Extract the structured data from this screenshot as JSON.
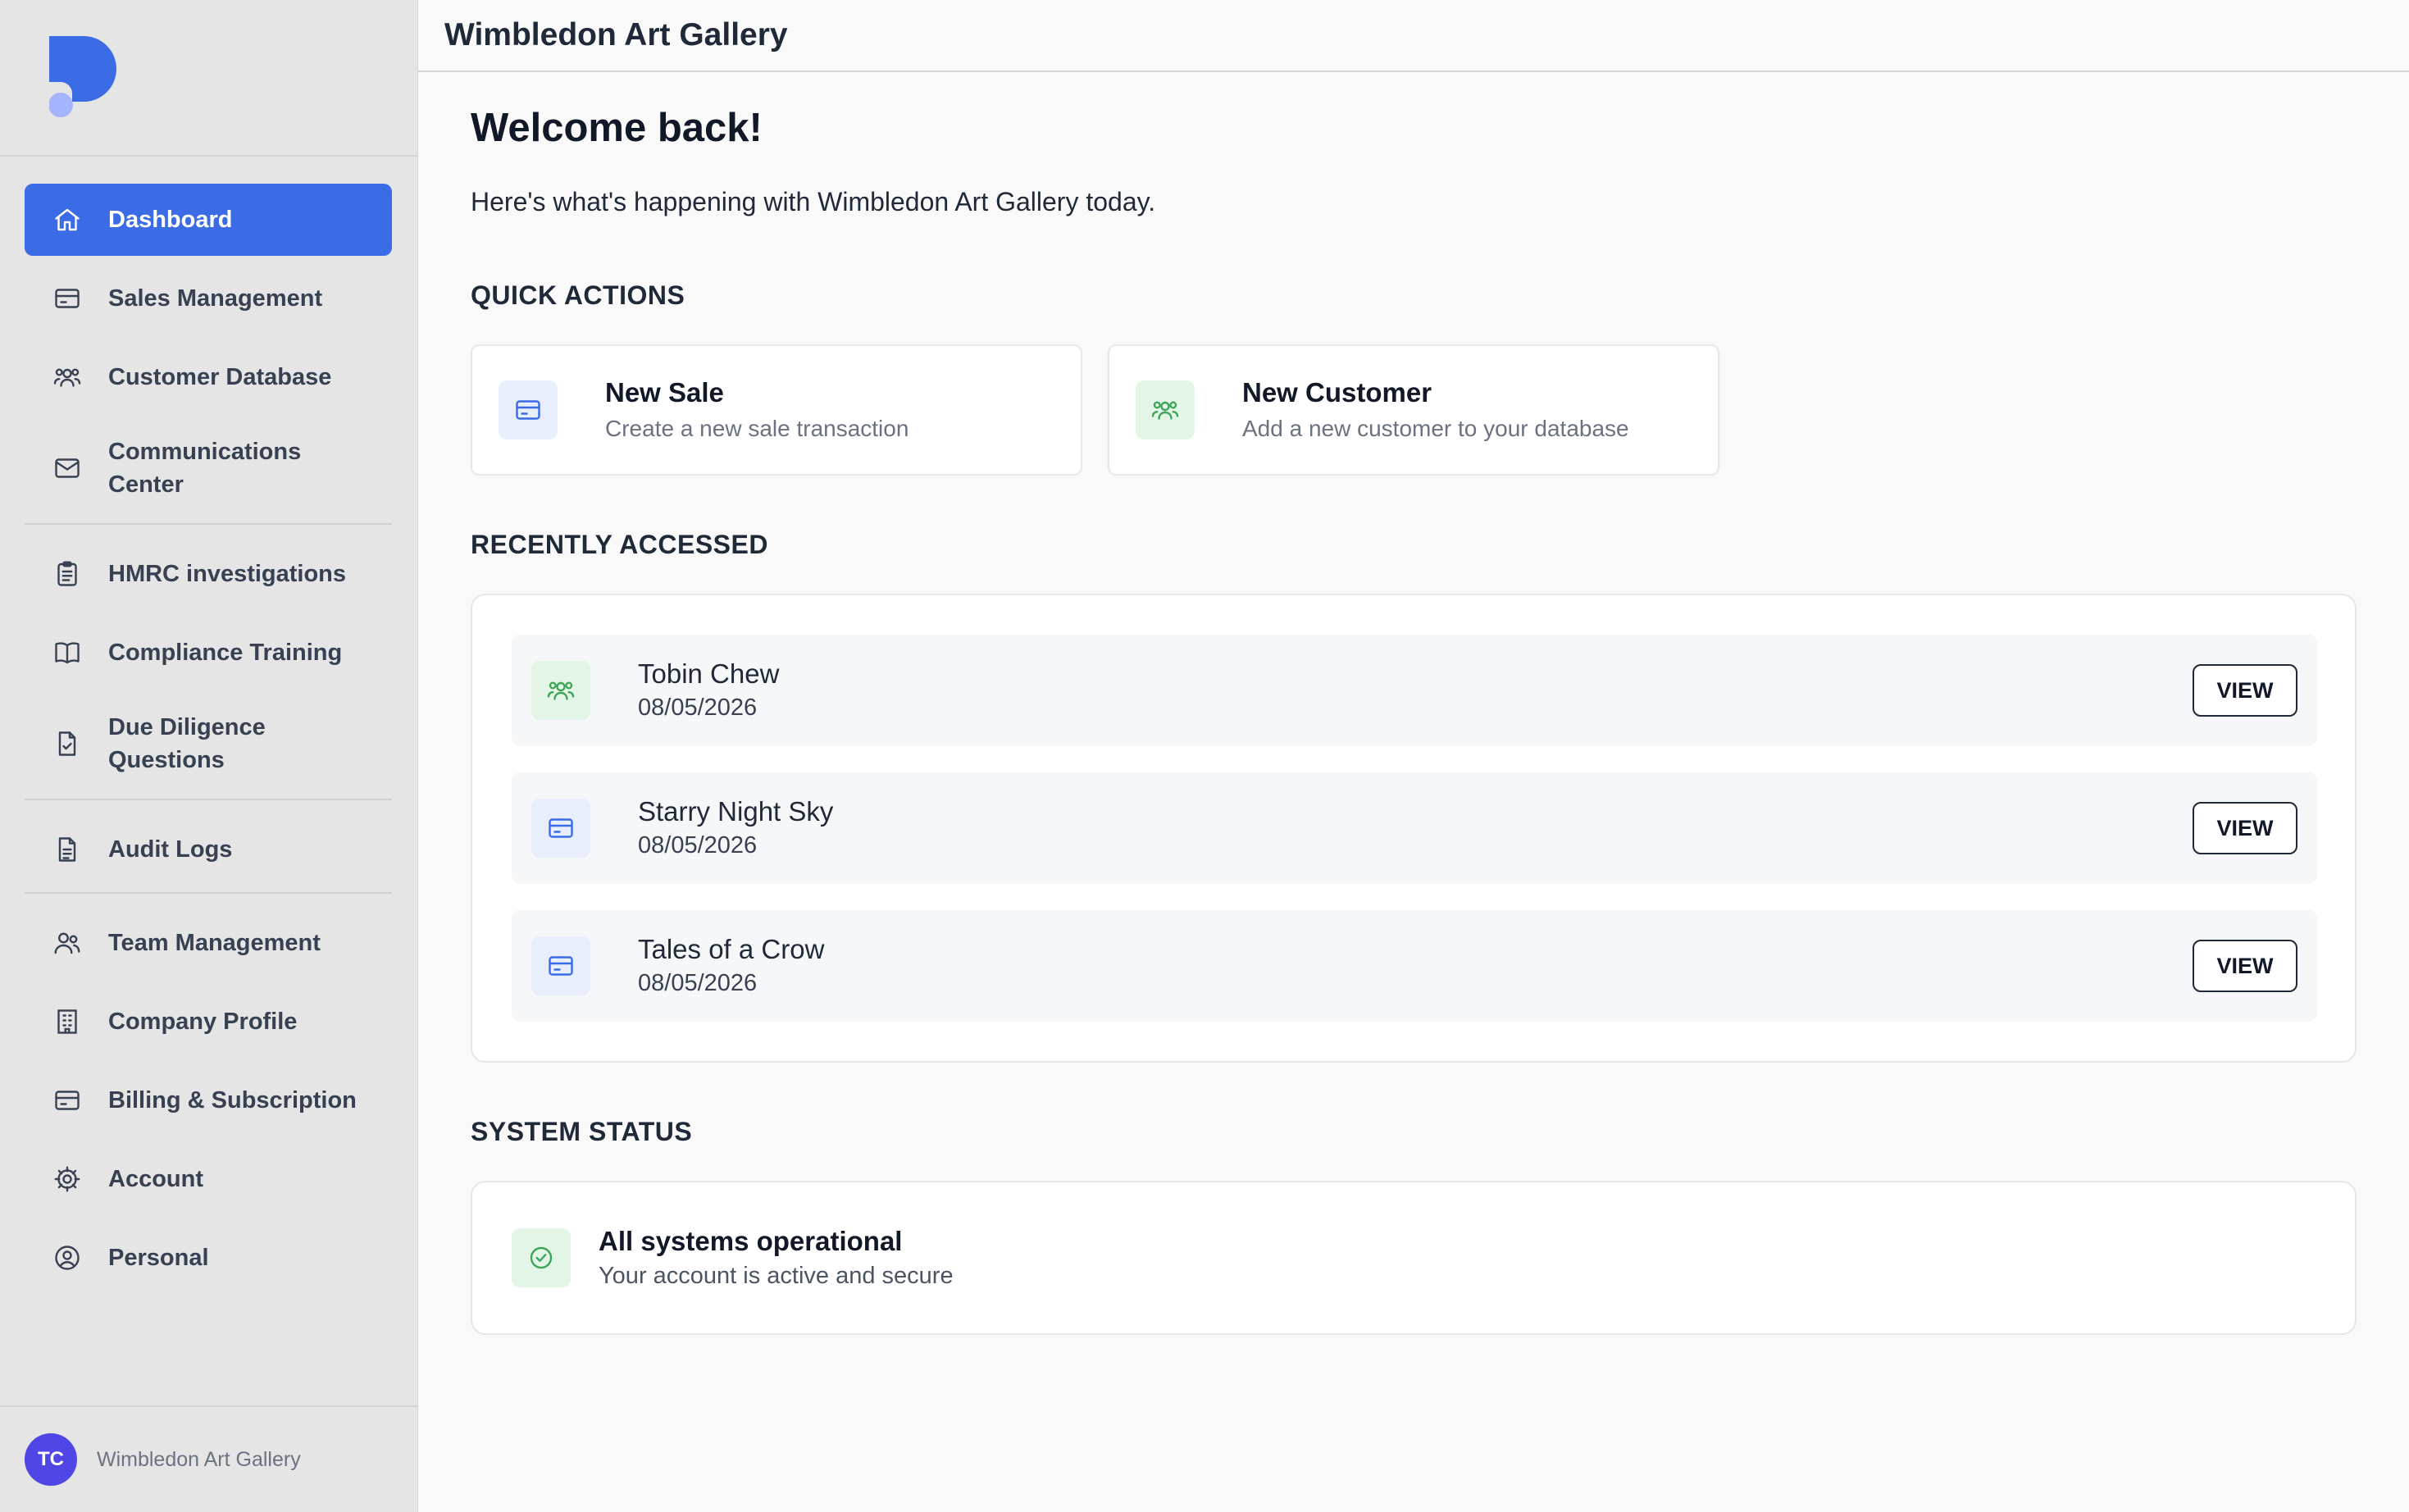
{
  "topbar": {
    "title": "Wimbledon Art Gallery"
  },
  "sidebar": {
    "items": [
      {
        "label": "Dashboard",
        "icon": "home-icon",
        "active": true
      },
      {
        "label": "Sales Management",
        "icon": "credit-card-icon"
      },
      {
        "label": "Customer Database",
        "icon": "users-group-icon"
      },
      {
        "label": "Communications Center",
        "icon": "mail-icon"
      },
      {
        "label": "HMRC investigations",
        "icon": "clipboard-icon"
      },
      {
        "label": "Compliance Training",
        "icon": "book-icon"
      },
      {
        "label": "Due Diligence Questions",
        "icon": "file-check-icon"
      },
      {
        "label": "Audit Logs",
        "icon": "file-text-icon"
      },
      {
        "label": "Team Management",
        "icon": "users-icon"
      },
      {
        "label": "Company Profile",
        "icon": "building-icon"
      },
      {
        "label": "Billing & Subscription",
        "icon": "credit-card-icon"
      },
      {
        "label": "Account",
        "icon": "gear-icon"
      },
      {
        "label": "Personal",
        "icon": "user-circle-icon"
      }
    ],
    "footer": {
      "initials": "TC",
      "name": "Wimbledon Art Gallery"
    }
  },
  "main": {
    "welcome": "Welcome back!",
    "subtitle": "Here's what's happening with Wimbledon Art Gallery today.",
    "quick_actions": {
      "title": "QUICK ACTIONS",
      "items": [
        {
          "title": "New Sale",
          "desc": "Create a new sale transaction",
          "icon": "credit-card-icon"
        },
        {
          "title": "New Customer",
          "desc": "Add a new customer to your database",
          "icon": "users-group-icon"
        }
      ]
    },
    "recently_accessed": {
      "title": "RECENTLY ACCESSED",
      "items": [
        {
          "name": "Tobin Chew",
          "date": "08/05/2026",
          "icon": "users-group-icon",
          "button": "VIEW"
        },
        {
          "name": "Starry Night Sky",
          "date": "08/05/2026",
          "icon": "credit-card-icon",
          "button": "VIEW"
        },
        {
          "name": "Tales of a Crow",
          "date": "08/05/2026",
          "icon": "credit-card-icon",
          "button": "VIEW"
        }
      ]
    },
    "system_status": {
      "title": "SYSTEM STATUS",
      "status_title": "All systems operational",
      "status_desc": "Your account is active and secure"
    }
  },
  "colors": {
    "accent": "#3b6be5",
    "sidebar_bg": "#e5e5e5",
    "avatar": "#4f46e5",
    "success": "#3fa55b"
  }
}
